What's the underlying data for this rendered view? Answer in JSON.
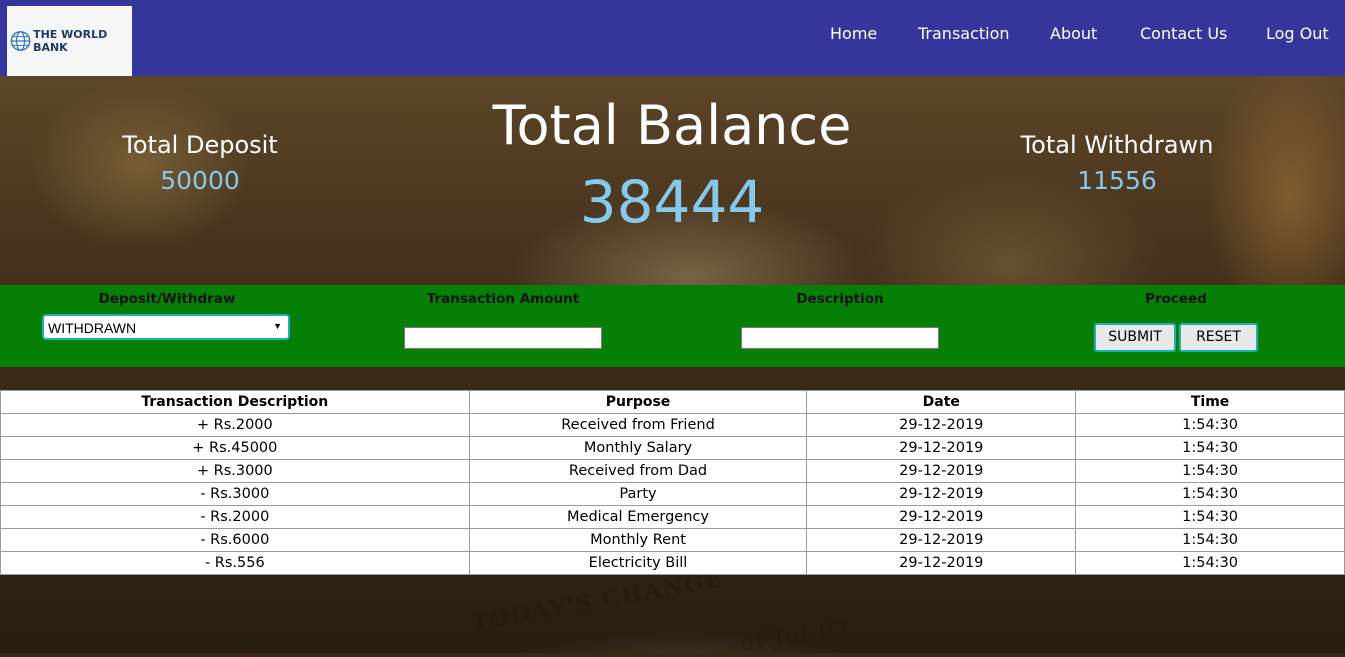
{
  "brand": {
    "name": "THE WORLD BANK"
  },
  "nav": {
    "items": [
      "Home",
      "Transaction",
      "About",
      "Contact Us",
      "Log Out"
    ]
  },
  "summary": {
    "deposit_label": "Total Deposit",
    "deposit_value": "50000",
    "balance_label": "Total Balance",
    "balance_value": "38444",
    "withdrawn_label": "Total Withdrawn",
    "withdrawn_value": "11556"
  },
  "form": {
    "type_label": "Deposit/Withdraw",
    "type_selected": "WITHDRAWN",
    "amount_label": "Transaction Amount",
    "amount_value": "",
    "description_label": "Description",
    "description_value": "",
    "proceed_label": "Proceed",
    "submit_label": "SUBMIT",
    "reset_label": "RESET"
  },
  "table": {
    "headers": [
      "Transaction Description",
      "Purpose",
      "Date",
      "Time"
    ],
    "rows": [
      {
        "amount": "+ Rs.2000",
        "sign": "pos",
        "purpose": "Received from Friend",
        "date": "29-12-2019",
        "time": "1:54:30"
      },
      {
        "amount": "+ Rs.45000",
        "sign": "pos",
        "purpose": "Monthly Salary",
        "date": "29-12-2019",
        "time": "1:54:30"
      },
      {
        "amount": "+ Rs.3000",
        "sign": "pos",
        "purpose": "Received from Dad",
        "date": "29-12-2019",
        "time": "1:54:30"
      },
      {
        "amount": "- Rs.3000",
        "sign": "neg",
        "purpose": "Party",
        "date": "29-12-2019",
        "time": "1:54:30"
      },
      {
        "amount": "- Rs.2000",
        "sign": "neg",
        "purpose": "Medical Emergency",
        "date": "29-12-2019",
        "time": "1:54:30"
      },
      {
        "amount": "- Rs.6000",
        "sign": "neg",
        "purpose": "Monthly Rent",
        "date": "29-12-2019",
        "time": "1:54:30"
      },
      {
        "amount": "- Rs.556",
        "sign": "neg",
        "purpose": "Electricity Bill",
        "date": "29-12-2019",
        "time": "1:54:30"
      }
    ]
  },
  "background": {
    "headline": "TODAY'S CHANGE",
    "dateline": "of Jul 07"
  },
  "colors": {
    "navbar": "#35369b",
    "form_bar": "#057f05",
    "accent_value": "#86c9ea",
    "deposit_text": "#0a6a0a",
    "withdraw_text": "#8b0000"
  }
}
